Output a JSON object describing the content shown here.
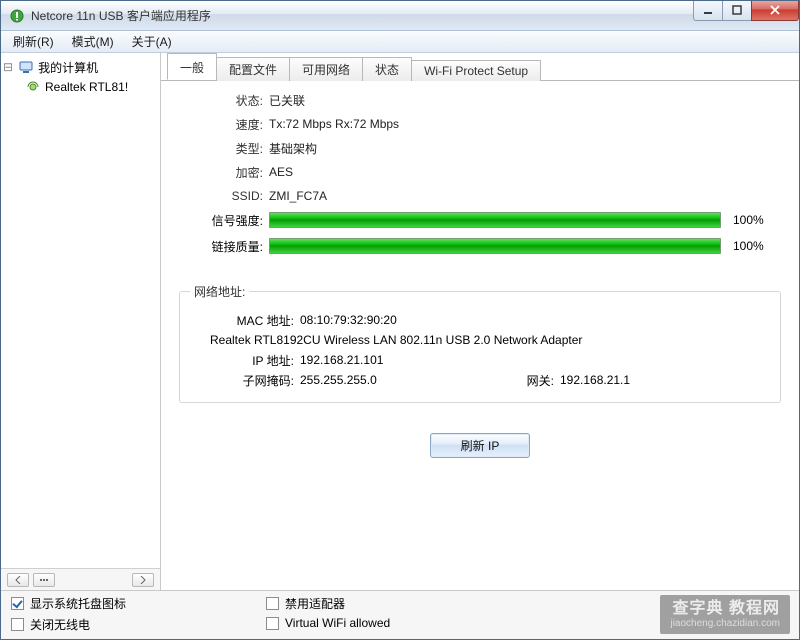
{
  "window": {
    "title": "Netcore 11n USB 客户端应用程序"
  },
  "menu": {
    "refresh": "刷新(R)",
    "mode": "模式(M)",
    "about": "关于(A)"
  },
  "tree": {
    "root": "我的计算机",
    "adapter": "Realtek RTL81!"
  },
  "tabs": {
    "general": "一般",
    "profile": "配置文件",
    "available": "可用网络",
    "status": "状态",
    "wps": "Wi-Fi Protect Setup"
  },
  "status": {
    "labels": {
      "state": "状态:",
      "speed": "速度:",
      "type": "类型:",
      "encryption": "加密:",
      "ssid": "SSID:",
      "signal": "信号强度:",
      "link": "链接质量:"
    },
    "values": {
      "state": "已关联",
      "speed": "Tx:72 Mbps Rx:72 Mbps",
      "type": "基础架构",
      "encryption": "AES",
      "ssid": "ZMI_FC7A"
    },
    "signal_pct": "100%",
    "link_pct": "100%"
  },
  "net": {
    "legend": "网络地址:",
    "labels": {
      "mac": "MAC 地址:",
      "ip": "IP 地址:",
      "mask": "子网掩码:",
      "gateway": "网关:"
    },
    "mac": "08:10:79:32:90:20",
    "adapter": "Realtek RTL8192CU Wireless LAN 802.11n USB 2.0 Network Adapter",
    "ip": "192.168.21.101",
    "mask": "255.255.255.0",
    "gateway": "192.168.21.1",
    "refresh_btn": "刷新 IP"
  },
  "footer": {
    "tray": "显示系统托盘图标",
    "radio_off": "关闭无线电",
    "disable_adapter": "禁用适配器",
    "virtual_wifi": "Virtual WiFi allowed"
  },
  "watermark": {
    "big": "查字典 教程网",
    "small": "jiaocheng.chazidian.com"
  }
}
